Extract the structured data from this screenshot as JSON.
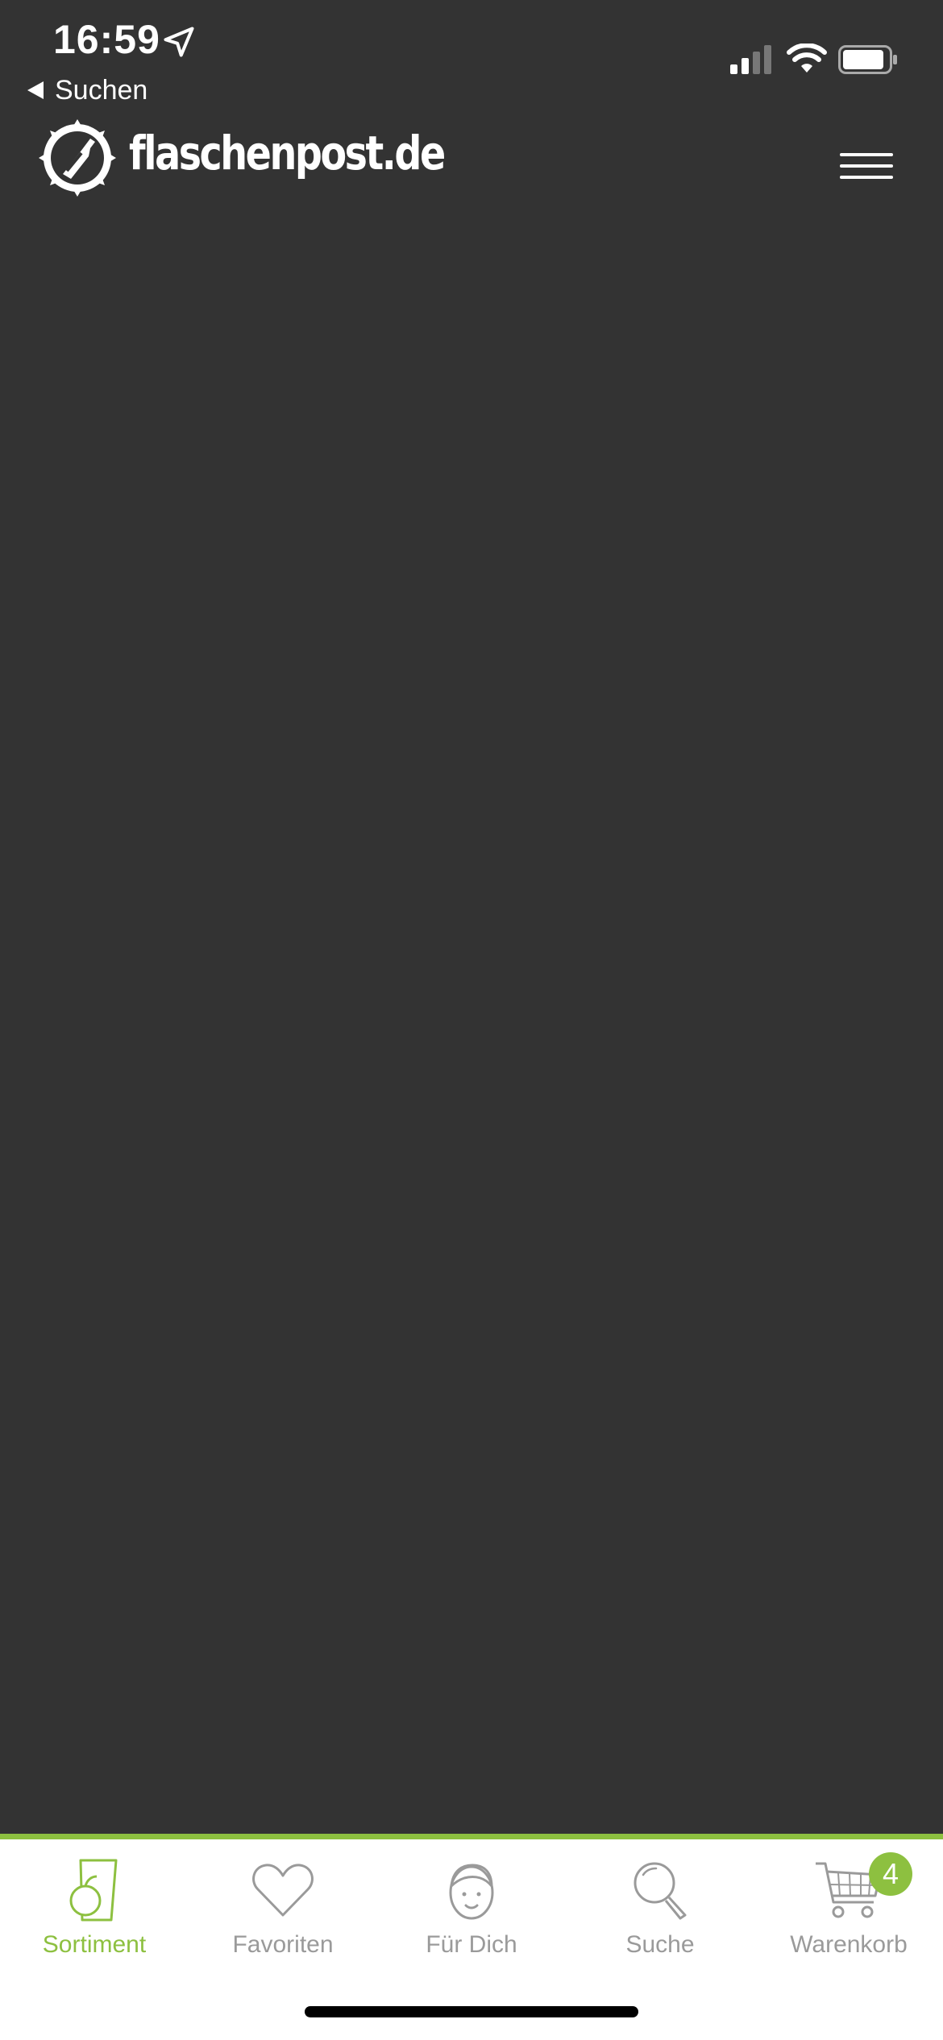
{
  "status_bar": {
    "time": "16:59",
    "back_label": "Suchen"
  },
  "header": {
    "logo_text": "flaschenpost.de"
  },
  "tab_bar": {
    "accent_color": "#8dc040",
    "inactive_color": "#9a9a9a",
    "tabs": [
      {
        "label": "Sortiment",
        "icon": "glass-icon",
        "active": true
      },
      {
        "label": "Favoriten",
        "icon": "heart-icon",
        "active": false
      },
      {
        "label": "Für Dich",
        "icon": "face-icon",
        "active": false
      },
      {
        "label": "Suche",
        "icon": "search-icon",
        "active": false
      },
      {
        "label": "Warenkorb",
        "icon": "cart-icon",
        "active": false,
        "badge": "4"
      }
    ]
  },
  "colors": {
    "background": "#333333",
    "tab_bar_background": "#ffffff"
  }
}
